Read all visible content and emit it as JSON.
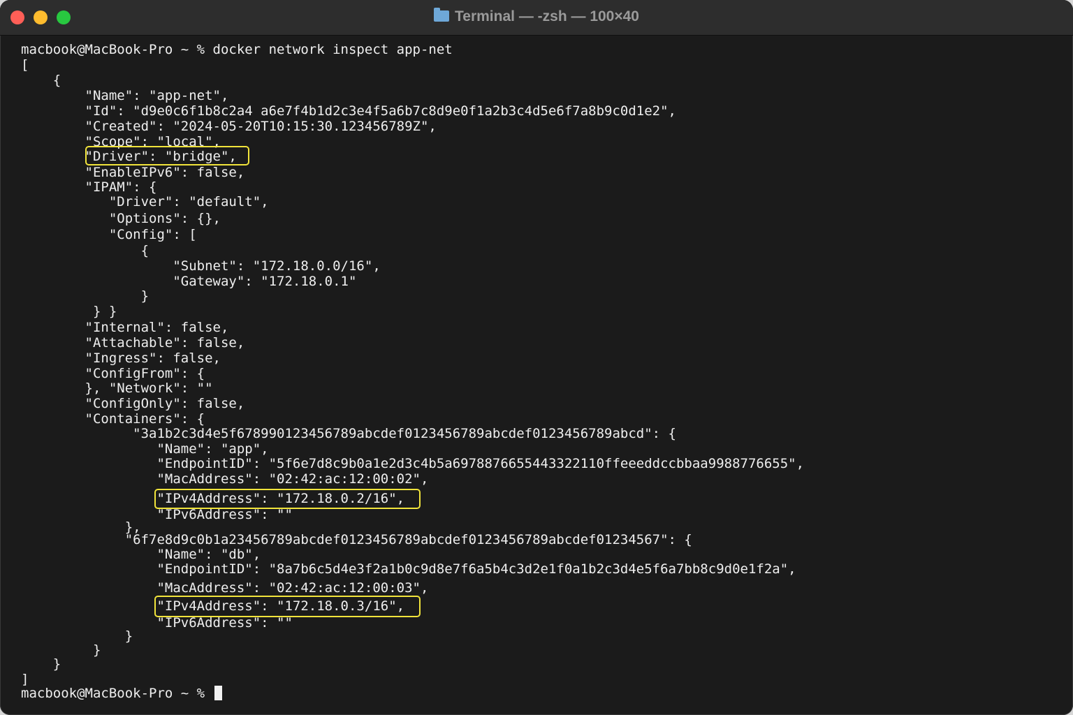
{
  "window": {
    "title": "Terminal — -zsh — 100×40"
  },
  "terminal": {
    "lines": [
      "macbook@MacBook-Pro ~ % docker network inspect app-net",
      "[",
      "    {",
      "        \"Name\": \"app-net\",",
      "        \"Id\": \"d9e0c6f1b8c2a4 a6e7f4b1d2c3e4f5a6b7c8d9e0f1a2b3c4d5e6f7a8b9c0d1e2\",",
      "        \"Created\": \"2024-05-20T10:15:30.123456789Z\",",
      "        \"Scope\": \"local\",",
      "        \"Driver\": \"bridge\",",
      "        \"EnableIPv6\": false,",
      "        \"IPAM\": {",
      "           \"Driver\": \"default\",",
      "           \"Options\": {},",
      "           \"Config\": [",
      "               {",
      "                   \"Subnet\": \"172.18.0.0/16\",",
      "                   \"Gateway\": \"172.18.0.1\"",
      "               }",
      "         } }",
      "        \"Internal\": false,",
      "        \"Attachable\": false,",
      "        \"Ingress\": false,",
      "        \"ConfigFrom\": {",
      "        }, \"Network\": \"\"",
      "        \"ConfigOnly\": false,",
      "        \"Containers\": {",
      "              \"3a1b2c3d4e5f678990123456789abcdef0123456789abcdef0123456789abcd\": {",
      "                 \"Name\": \"app\",",
      "                 \"EndpointID\": \"5f6e7d8c9b0a1e2d3c4b5a69788766554433221​10ffeeeddccbbaa9988776655\",",
      "                 \"MacAddress\": \"02:42:ac:12:00:02\",",
      "                 \"IPv4Address\": \"172.18.0.2/16\",",
      "                 \"IPv6Address\": \"\"",
      "             },",
      "             \"6f7e8d9c0b1a23456789abcdef0123456789abcdef0123456789abcdef01234567\": {",
      "                 \"Name\": \"db\",",
      "                 \"EndpointID\": \"8a7b6c5d4e3f2a1b0c9d8e7f6a5b4c3d2e1f0a1b2c3d4e5f6a7bb8c9d0e1f2a\",",
      "                 \"MacAddress\": \"02:42:ac:12:00:03\",",
      "                 \"IPv4Address\": \"172.18.0.3/16\",",
      "                 \"IPv6Address\": \"\"",
      "             }",
      "         }",
      "    }",
      "]"
    ],
    "prompt": "macbook@MacBook-Pro ~ % "
  },
  "highlight_color": "#f1e43b"
}
